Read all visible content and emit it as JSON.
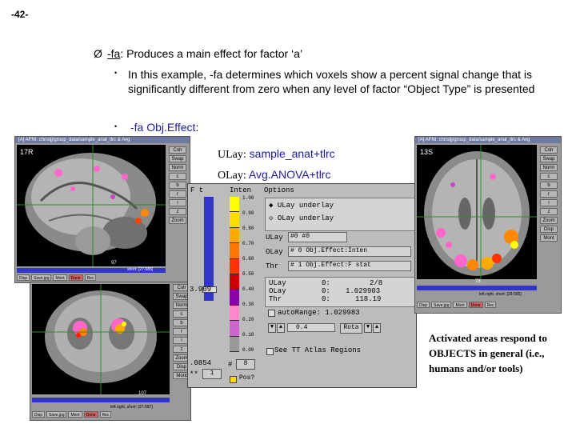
{
  "page_number": "-42-",
  "bullets": {
    "arrow_glyph": "Ø",
    "main": {
      "option": "-fa",
      "text": ": Produces a main effect for factor ‘a’"
    },
    "sub1": "In this example, -fa determines which voxels show a percent signal change that is significantly different from zero when any level of factor “Object Type” is presented",
    "sub2": "-fa Obj.Effect",
    "sub2_colon": ":"
  },
  "labels": {
    "ulay_key": "ULay:",
    "ulay_value": "sample_anat+tlrc",
    "olay_key": "OLay:",
    "olay_value": "Avg.ANOVA+tlrc"
  },
  "note": "Activated areas respond to OBJECTS in general (i.e., humans and/or tools)",
  "afni": {
    "sagittal_title": "[A] AFNI: christjj/group_data/sample_anat_tlrc & Avg",
    "axial_title": "[A] AFNI: christjj/group_data/sample_anat_tlrc & Avg",
    "coronal_title": "[A] AFNI: christjj/group_data/sample_anat_tlrc & Avg",
    "sagittal_corner": "17R",
    "axial_corner": "13S",
    "side_buttons": [
      "Colr",
      "Swap",
      "Norm",
      "c",
      "b",
      "r",
      "i",
      "z",
      "Zoom",
      "Disp",
      "Mont"
    ],
    "bottom_buttons": [
      "Disp",
      "Save.jpg",
      "Mont",
      "Done",
      "Rec"
    ],
    "slider_val_sag": "97",
    "slider_val_ax": "78",
    "slider_val_cor": "107",
    "slider_note": "short: [27-585]",
    "axial_slider_note": "left.right, short: [28-585]",
    "coronal_slider_note": "left.right, short: [27-587]",
    "panel": {
      "col1": "F t",
      "col2": "Inten",
      "col3": "Options",
      "ulay_underlay": "ULay underlay",
      "olay_underlay": "OLay underlay",
      "ulay_field": "#0 #0",
      "olay_field": "# 0 Obj.Effect:Inten",
      "thr_field": "# 1 Obj.Effect:F stat",
      "ulay_row_label": "ULay",
      "olay_row_label": "OLay",
      "thr_row_label": "Thr",
      "ulay_o": "0:",
      "olay_o": "0:",
      "thr_o": "0:",
      "ulay_row_val": "2/8",
      "olay_row_val": "1.029903",
      "thr_row_val": "118.19",
      "auto_range": "autoRange: 1.029983",
      "scale_val": "0.4",
      "rota": "Rota",
      "atlas": "See TT Atlas Regions",
      "threshold": "3.909",
      "pval": ".0854",
      "pow_label": "**",
      "pow_val": "1",
      "hash_label": "#",
      "hash_val": "8",
      "posfunc": "Pos?",
      "ticks": [
        "1.00",
        "0.90",
        "0.80",
        "0.70",
        "0.60",
        "0.50",
        "0.40",
        "0.30",
        "0.20",
        "0.10",
        "0.00"
      ],
      "colorbar": [
        "#ffff00",
        "#ffdd00",
        "#ffaa00",
        "#ff7700",
        "#ff3300",
        "#cc0000",
        "#8800aa",
        "#ff88cc",
        "#cc66cc",
        "#999999"
      ]
    }
  }
}
